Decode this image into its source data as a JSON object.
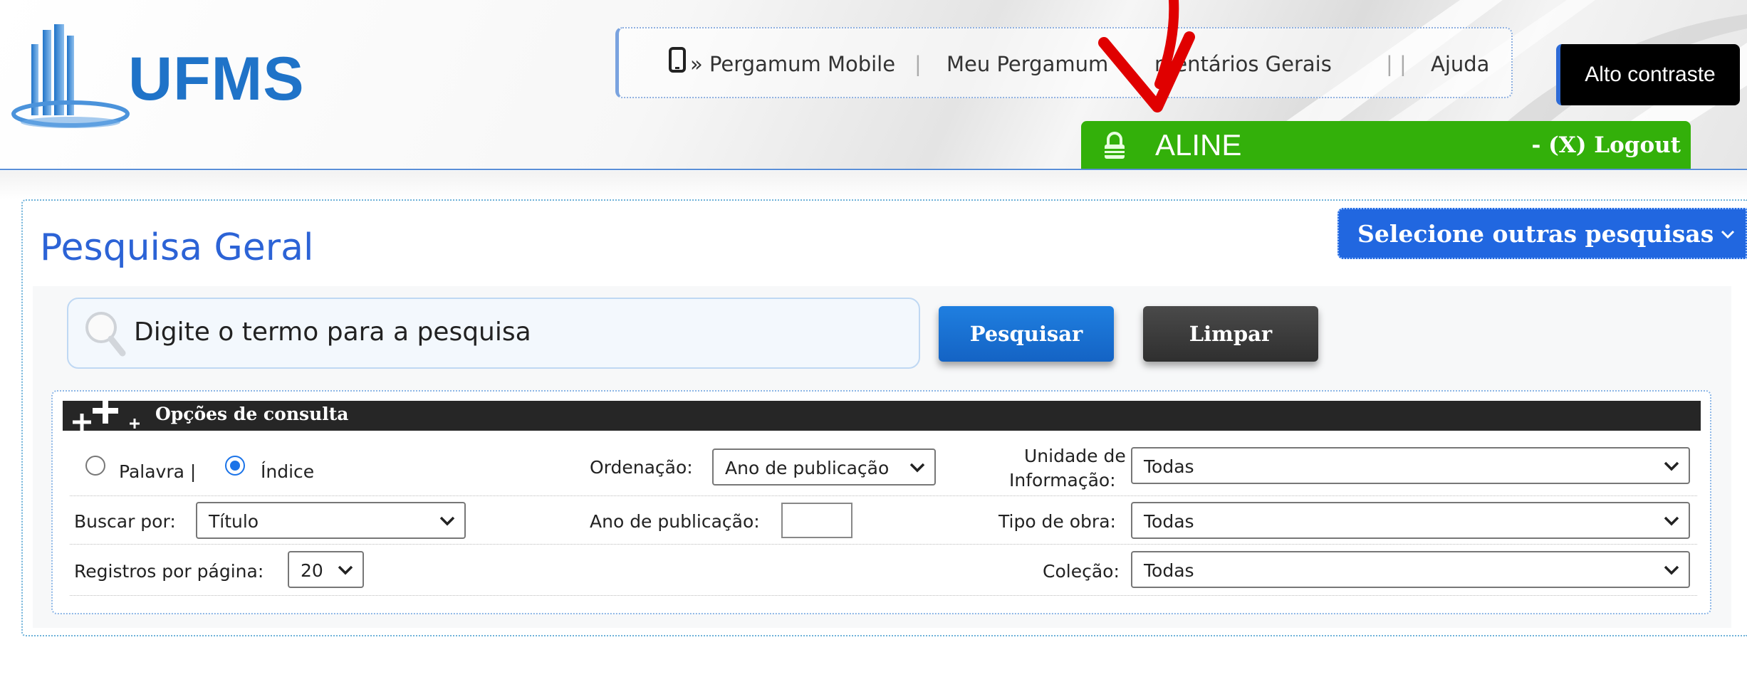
{
  "header": {
    "logo_text": "UFMS",
    "nav": {
      "mobile": "» Pergamum Mobile",
      "sep1": "|",
      "meu_pergamum": "Meu Pergamum",
      "comentarios": "mentários Gerais",
      "sep3": "| |",
      "ajuda": "Ajuda"
    },
    "contrast_button": "Alto contraste",
    "user": {
      "name": "ALINE",
      "logout": "- (X) Logout"
    }
  },
  "panel": {
    "title": "Pesquisa Geral",
    "other_searches": "Selecione outras pesquisas",
    "search_placeholder": "Digite o termo para a pesquisa",
    "search_button": "Pesquisar",
    "clear_button": "Limpar"
  },
  "options": {
    "title": "Opções de consulta",
    "radio_palavra": "Palavra |",
    "radio_indice": "Índice",
    "selected_mode": "Índice",
    "ordenacao_label": "Ordenação:",
    "ordenacao_value": "Ano de publicação",
    "unidade_label_1": "Unidade de",
    "unidade_label_2": "Informação:",
    "unidade_value": "Todas",
    "buscar_label": "Buscar por:",
    "buscar_value": "Título",
    "ano_label": "Ano de publicação:",
    "ano_value": "",
    "tipo_label": "Tipo de obra:",
    "tipo_value": "Todas",
    "registros_label": "Registros por página:",
    "registros_value": "20",
    "colecao_label": "Coleção:",
    "colecao_value": "Todas"
  },
  "colors": {
    "brand_blue": "#1f73c8",
    "user_bar_green": "#33b00a",
    "primary_button": "#1463c4",
    "title_blue": "#2c63d6"
  }
}
